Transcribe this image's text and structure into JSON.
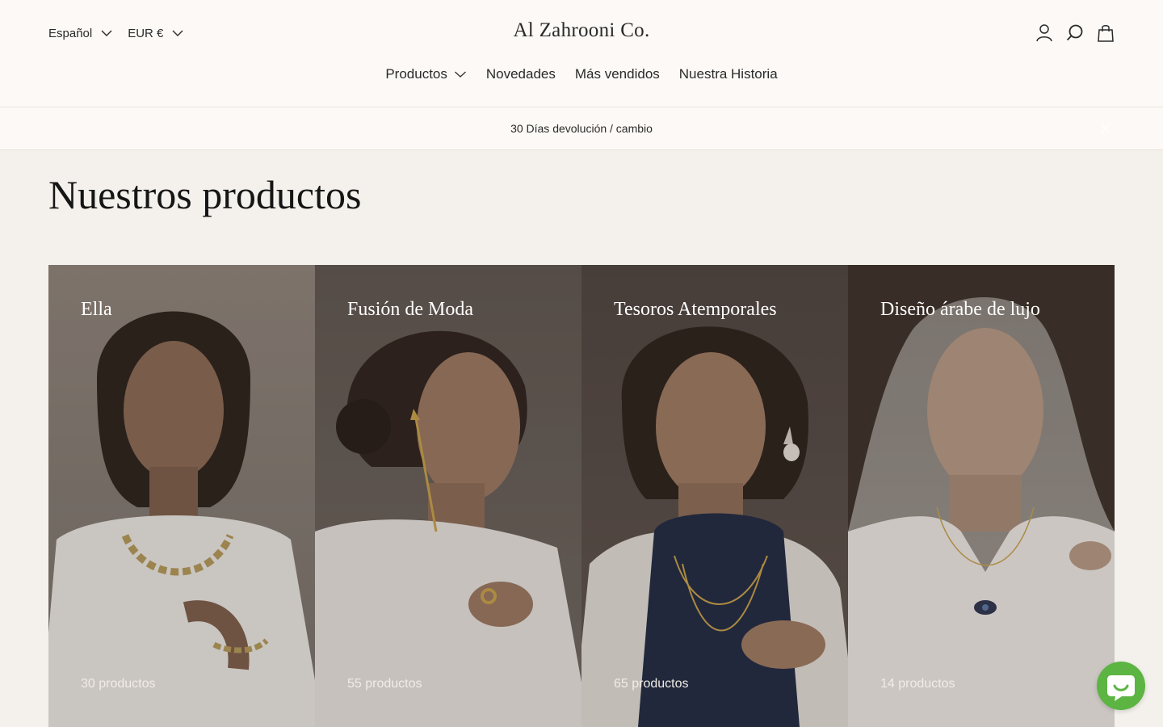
{
  "header": {
    "language": "Español",
    "currency": "EUR €",
    "logo": "Al Zahrooni Co.",
    "icons": [
      "account-icon",
      "search-icon",
      "bag-icon"
    ]
  },
  "nav": {
    "items": [
      {
        "label": "Productos",
        "has_dropdown": true
      },
      {
        "label": "Novedades"
      },
      {
        "label": "Más vendidos"
      },
      {
        "label": "Nuestra Historia"
      }
    ]
  },
  "announcement": {
    "text": "30 Días devolución / cambio"
  },
  "page": {
    "title": "Nuestros productos"
  },
  "collections": [
    {
      "title": "Ella",
      "count": "30 productos"
    },
    {
      "title": "Fusión de Moda",
      "count": "55 productos"
    },
    {
      "title": "Tesoros Atemporales",
      "count": "65 productos"
    },
    {
      "title": "Diseño árabe de lujo",
      "count": "14 productos"
    }
  ],
  "colors": {
    "background": "#f4f1ec",
    "header_bg": "#fcf9f6",
    "text": "#2a2a2a",
    "chat_button": "#5cb443"
  }
}
